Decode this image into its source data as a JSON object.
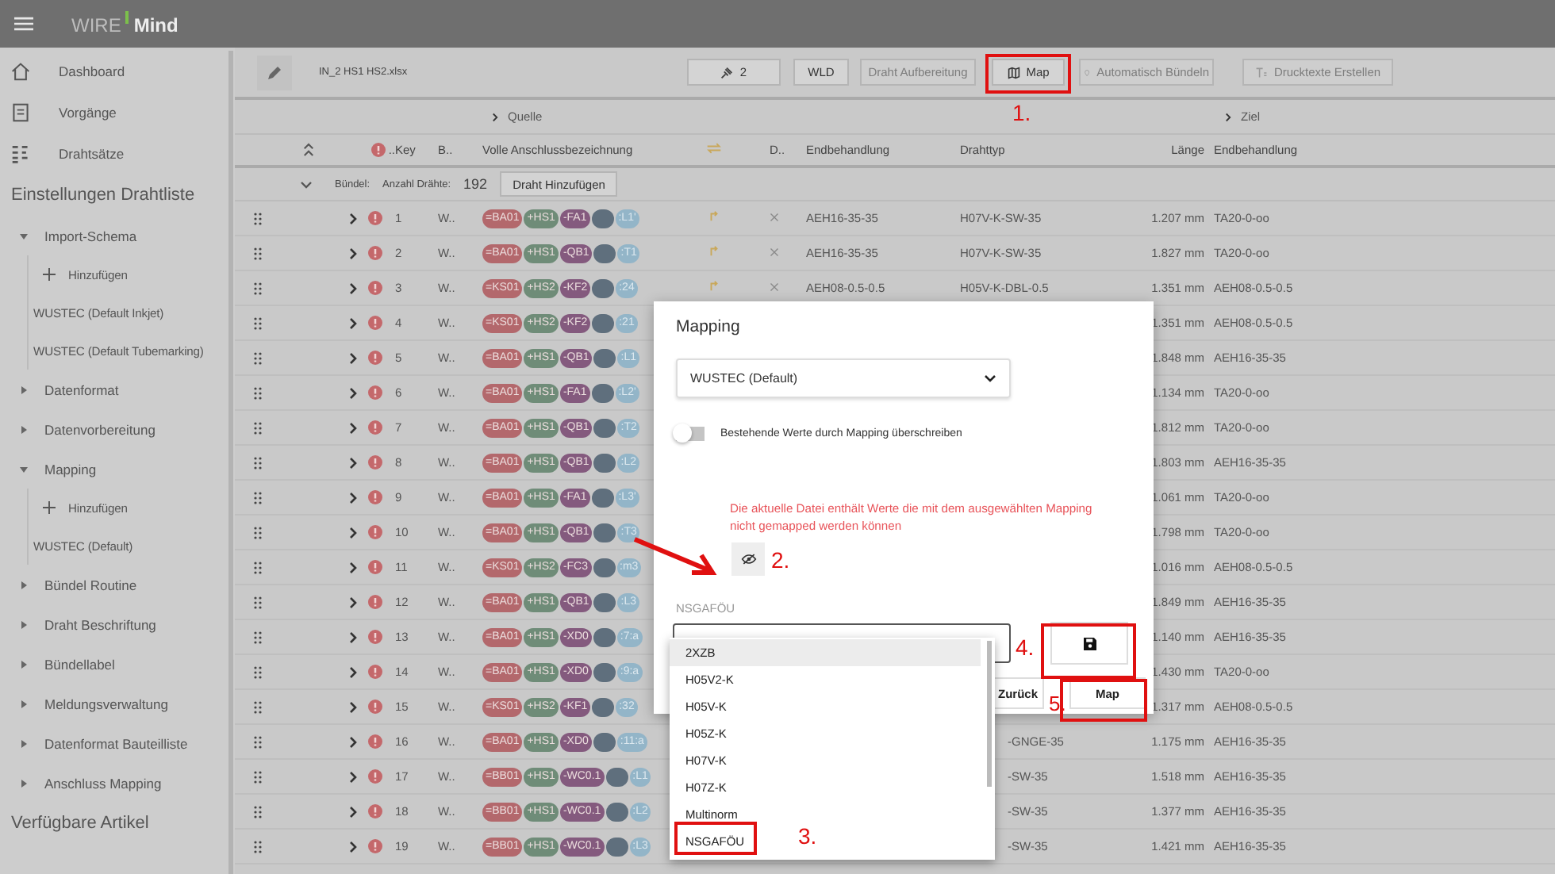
{
  "app_bar": {
    "logo_left": "WIRE",
    "logo_right": "Mind"
  },
  "sidebar": {
    "nav": [
      {
        "label": "Dashboard",
        "kind": "home"
      },
      {
        "label": "Vorgänge",
        "kind": "document"
      },
      {
        "label": "Drahtsätze",
        "kind": "list"
      }
    ],
    "sections": [
      {
        "title": "Einstellungen Drahtliste",
        "items": [
          {
            "label": "Import-Schema",
            "expanded": true,
            "children": [
              {
                "label": "Hinzufügen",
                "kind": "add"
              },
              {
                "label": "WUSTEC (Default Inkjet)",
                "kind": "entry"
              },
              {
                "label": "WUSTEC (Default Tubemarking)",
                "kind": "entry"
              }
            ]
          },
          {
            "label": "Datenformat",
            "expanded": false
          },
          {
            "label": "Datenvorbereitung",
            "expanded": false
          },
          {
            "label": "Mapping",
            "expanded": true,
            "children": [
              {
                "label": "Hinzufügen",
                "kind": "add"
              },
              {
                "label": "WUSTEC (Default)",
                "kind": "entry"
              }
            ]
          },
          {
            "label": "Bündel Routine",
            "expanded": false
          },
          {
            "label": "Draht Beschriftung",
            "expanded": false
          },
          {
            "label": "Bündellabel",
            "expanded": false
          },
          {
            "label": "Meldungsverwaltung",
            "expanded": false
          },
          {
            "label": "Datenformat Bauteilliste",
            "expanded": false
          },
          {
            "label": "Anschluss Mapping",
            "expanded": false
          }
        ]
      },
      {
        "title": "Verfügbare Artikel"
      }
    ]
  },
  "toolbar": {
    "file_name": "IN_2 HS1 HS2.xlsx",
    "buttons": [
      {
        "label": "2",
        "kind": "pin",
        "disabled": false
      },
      {
        "label": "WLD",
        "kind": "text",
        "disabled": false
      },
      {
        "label": "Draht Aufbereitung",
        "kind": "text",
        "disabled": true
      },
      {
        "label": "Map",
        "kind": "map",
        "disabled": false
      },
      {
        "label": "Automatisch Bündeln",
        "kind": "marker",
        "disabled": true
      },
      {
        "label": "Drucktexte Erstellen",
        "kind": "print",
        "disabled": true
      }
    ]
  },
  "table": {
    "groups": [
      {
        "label": "Quelle"
      },
      {
        "label": "Ziel"
      }
    ],
    "columns": [
      {
        "kind": "alert",
        "label": ".."
      },
      {
        "kind": "text",
        "label": "Key"
      },
      {
        "kind": "text",
        "label": "B.."
      },
      {
        "kind": "text",
        "label": "Volle Anschlussbezeichnung"
      },
      {
        "kind": "swap"
      },
      {
        "kind": "text",
        "label": "D.."
      },
      {
        "kind": "text",
        "label": "Endbehandlung"
      },
      {
        "kind": "text",
        "label": "Drahttyp"
      },
      {
        "kind": "number",
        "label": "Länge"
      },
      {
        "kind": "text",
        "label": "Endbehandlung"
      }
    ],
    "bundle": {
      "label": "Bündel:",
      "count_label": "Anzahl Drähte:",
      "count": "192",
      "button": "Draht Hinzufügen"
    },
    "rows": [
      {
        "key": "1",
        "b": "W..",
        "tags": [
          "=BA01",
          "+HS1",
          "-FA1",
          ":L1'"
        ],
        "endbehandlung": "AEH16-35-35",
        "drahttyp": "H07V-K-SW-35",
        "laenge": "1.207 mm",
        "ziel": "TA20-0-oo"
      },
      {
        "key": "2",
        "b": "W..",
        "tags": [
          "=BA01",
          "+HS1",
          "-QB1",
          ":T1"
        ],
        "endbehandlung": "AEH16-35-35",
        "drahttyp": "H07V-K-SW-35",
        "laenge": "1.827 mm",
        "ziel": "TA20-0-oo"
      },
      {
        "key": "3",
        "b": "W..",
        "tags": [
          "=KS01",
          "+HS2",
          "-KF2",
          ":24"
        ],
        "endbehandlung": "AEH08-0.5-0.5",
        "drahttyp": "H05V-K-DBL-0.5",
        "laenge": "1.351 mm",
        "ziel": "AEH08-0.5-0.5"
      },
      {
        "key": "4",
        "b": "W..",
        "tags": [
          "=KS01",
          "+HS2",
          "-KF2",
          ":21"
        ],
        "laenge": "1.351 mm",
        "ziel": "AEH08-0.5-0.5"
      },
      {
        "key": "5",
        "b": "W..",
        "tags": [
          "=BA01",
          "+HS1",
          "-QB1",
          ":L1"
        ],
        "laenge": "1.848 mm",
        "ziel": "AEH16-35-35"
      },
      {
        "key": "6",
        "b": "W..",
        "tags": [
          "=BA01",
          "+HS1",
          "-FA1",
          ":L2'"
        ],
        "laenge": "1.134 mm",
        "ziel": "TA20-0-oo"
      },
      {
        "key": "7",
        "b": "W..",
        "tags": [
          "=BA01",
          "+HS1",
          "-QB1",
          ":T2"
        ],
        "laenge": "1.812 mm",
        "ziel": "TA20-0-oo"
      },
      {
        "key": "8",
        "b": "W..",
        "tags": [
          "=BA01",
          "+HS1",
          "-QB1",
          ":L2"
        ],
        "laenge": "1.803 mm",
        "ziel": "AEH16-35-35"
      },
      {
        "key": "9",
        "b": "W..",
        "tags": [
          "=BA01",
          "+HS1",
          "-FA1",
          ":L3'"
        ],
        "laenge": "1.061 mm",
        "ziel": "TA20-0-oo"
      },
      {
        "key": "10",
        "b": "W..",
        "tags": [
          "=BA01",
          "+HS1",
          "-QB1",
          ":T3"
        ],
        "laenge": "1.798 mm",
        "ziel": "TA20-0-oo"
      },
      {
        "key": "11",
        "b": "W..",
        "tags": [
          "=KS01",
          "+HS2",
          "-FC3",
          ":m3"
        ],
        "laenge": "1.016 mm",
        "ziel": "AEH08-0.5-0.5"
      },
      {
        "key": "12",
        "b": "W..",
        "tags": [
          "=BA01",
          "+HS1",
          "-QB1",
          ":L3"
        ],
        "laenge": "1.849 mm",
        "ziel": "AEH16-35-35"
      },
      {
        "key": "13",
        "b": "W..",
        "tags": [
          "=BA01",
          "+HS1",
          "-XD0",
          ":7:a"
        ],
        "laenge": "1.140 mm",
        "ziel": "AEH16-35-35"
      },
      {
        "key": "14",
        "b": "W..",
        "tags": [
          "=BA01",
          "+HS1",
          "-XD0",
          ":9:a"
        ],
        "laenge": "1.430 mm",
        "ziel": "TA20-0-oo"
      },
      {
        "key": "15",
        "b": "W..",
        "tags": [
          "=KS01",
          "+HS2",
          "-KF1",
          ":32"
        ],
        "laenge": "1.317 mm",
        "ziel": "AEH08-0.5-0.5"
      },
      {
        "key": "16",
        "b": "W..",
        "tags": [
          "=BA01",
          "+HS1",
          "-XD0",
          ":11:a"
        ],
        "drahttyp": "-GNGE-35",
        "laenge": "1.175 mm",
        "ziel": "AEH16-35-35"
      },
      {
        "key": "17",
        "b": "W..",
        "tags": [
          "=BB01",
          "+HS1",
          "-WC0.1",
          ":L1"
        ],
        "drahttyp": "-SW-35",
        "laenge": "1.518 mm",
        "ziel": "AEH16-35-35"
      },
      {
        "key": "18",
        "b": "W..",
        "tags": [
          "=BB01",
          "+HS1",
          "-WC0.1",
          ":L2"
        ],
        "drahttyp": "-SW-35",
        "laenge": "1.377 mm",
        "ziel": "AEH16-35-35"
      },
      {
        "key": "19",
        "b": "W..",
        "tags": [
          "=BB01",
          "+HS1",
          "-WC0.1",
          ":L3"
        ],
        "drahttyp": "-SW-35",
        "laenge": "1.421 mm",
        "ziel": "AEH16-35-35"
      }
    ]
  },
  "modal": {
    "title": "Mapping",
    "select": "WUSTEC (Default)",
    "toggle": {
      "label": "Bestehende Werte durch Mapping überschreiben",
      "on": false
    },
    "warning": "Die aktuelle Datei enthält Werte die mit dem ausgewählten Mapping nicht gemapped werden können",
    "field_label": "NSGAFÖU",
    "options": [
      {
        "label": "2XZB",
        "selected": true
      },
      {
        "label": "H05V2-K",
        "selected": false
      },
      {
        "label": "H05V-K",
        "selected": false
      },
      {
        "label": "H05Z-K",
        "selected": false
      },
      {
        "label": "H07V-K",
        "selected": false
      },
      {
        "label": "H07Z-K",
        "selected": false
      },
      {
        "label": "Multinorm",
        "selected": false
      },
      {
        "label": "NSGAFÖU",
        "selected": false
      }
    ],
    "buttons": [
      {
        "label": "Zurück"
      },
      {
        "label": "Map"
      }
    ]
  },
  "annotations": [
    {
      "label": "1.",
      "kind": "toolbar-map"
    },
    {
      "label": "2.",
      "kind": "eye"
    },
    {
      "label": "3.",
      "kind": "option"
    },
    {
      "label": "4.",
      "kind": "save"
    },
    {
      "label": "5.",
      "kind": "map"
    }
  ]
}
